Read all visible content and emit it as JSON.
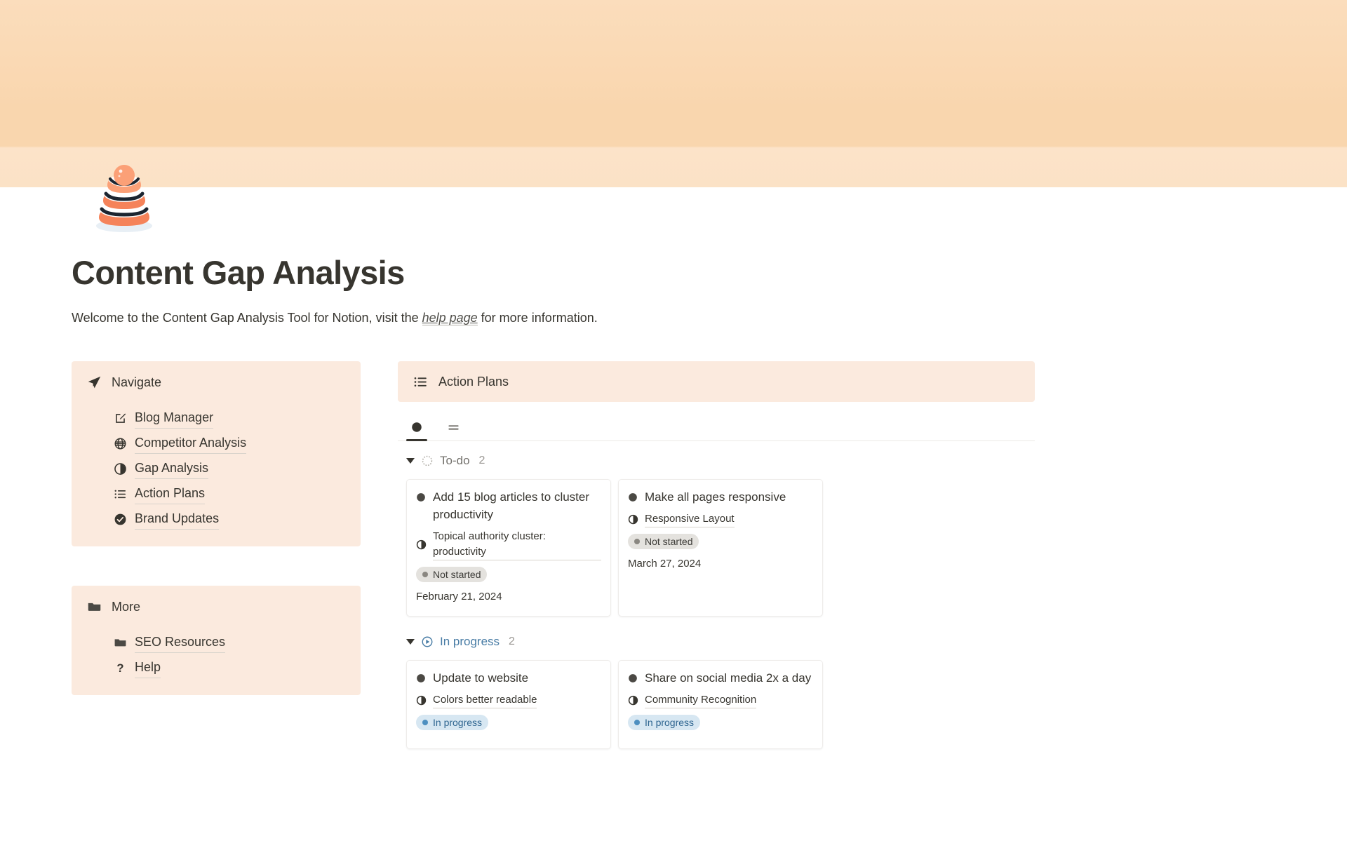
{
  "cover": {
    "gradient_top": "#fbddbc",
    "gradient_bottom": "#fbe2c6"
  },
  "page_icon": {
    "name": "layered-cake-icon",
    "colors": [
      "#f5835a",
      "#fba077",
      "#ffffff",
      "#1c2530",
      "#e8eff5"
    ]
  },
  "header": {
    "title": "Content Gap Analysis",
    "subtitle_before": "Welcome to the Content Gap Analysis Tool for Notion, visit the ",
    "subtitle_link": "help page",
    "subtitle_after": " for more information."
  },
  "sidebar": {
    "navigate": {
      "icon": "paper-plane-icon",
      "title": "Navigate",
      "items": [
        {
          "icon": "edit-square-icon",
          "label": "Blog Manager"
        },
        {
          "icon": "globe-icon",
          "label": "Competitor Analysis"
        },
        {
          "icon": "pie-half-icon",
          "label": "Gap Analysis"
        },
        {
          "icon": "list-icon",
          "label": "Action Plans"
        },
        {
          "icon": "check-circle-icon",
          "label": "Brand Updates"
        }
      ]
    },
    "more": {
      "icon": "folder-icon",
      "title": "More",
      "items": [
        {
          "icon": "folder-icon",
          "label": "SEO Resources"
        },
        {
          "icon": "question-mark-icon",
          "label": "Help"
        }
      ]
    }
  },
  "main": {
    "callout": {
      "icon": "list-icon",
      "title": "Action Plans"
    },
    "view_tabs": [
      {
        "name": "board-view-tab",
        "icon": "filled-circle-icon",
        "active": true
      },
      {
        "name": "table-view-tab",
        "icon": "equals-lines-icon",
        "active": false
      }
    ],
    "groups": [
      {
        "name": "To-do",
        "icon": "dashed-circle-icon",
        "count": "2",
        "color": "#73716c",
        "cards": [
          {
            "title": "Add 15 blog articles to cluster productivity",
            "relation": "Topical authority cluster: productivity",
            "status": "Not started",
            "status_color": "gray",
            "date": "February 21, 2024"
          },
          {
            "title": "Make all pages responsive",
            "relation": "Responsive Layout",
            "status": "Not started",
            "status_color": "gray",
            "date": "March 27, 2024"
          }
        ]
      },
      {
        "name": "In progress",
        "icon": "play-circle-icon",
        "count": "2",
        "color": "#487ca5",
        "cards": [
          {
            "title": "Update to website",
            "relation": "Colors better readable",
            "status": "In progress",
            "status_color": "blue",
            "date": ""
          },
          {
            "title": "Share on social media 2x a day",
            "relation": "Community Recognition",
            "status": "In progress",
            "status_color": "blue",
            "date": ""
          }
        ]
      }
    ]
  }
}
